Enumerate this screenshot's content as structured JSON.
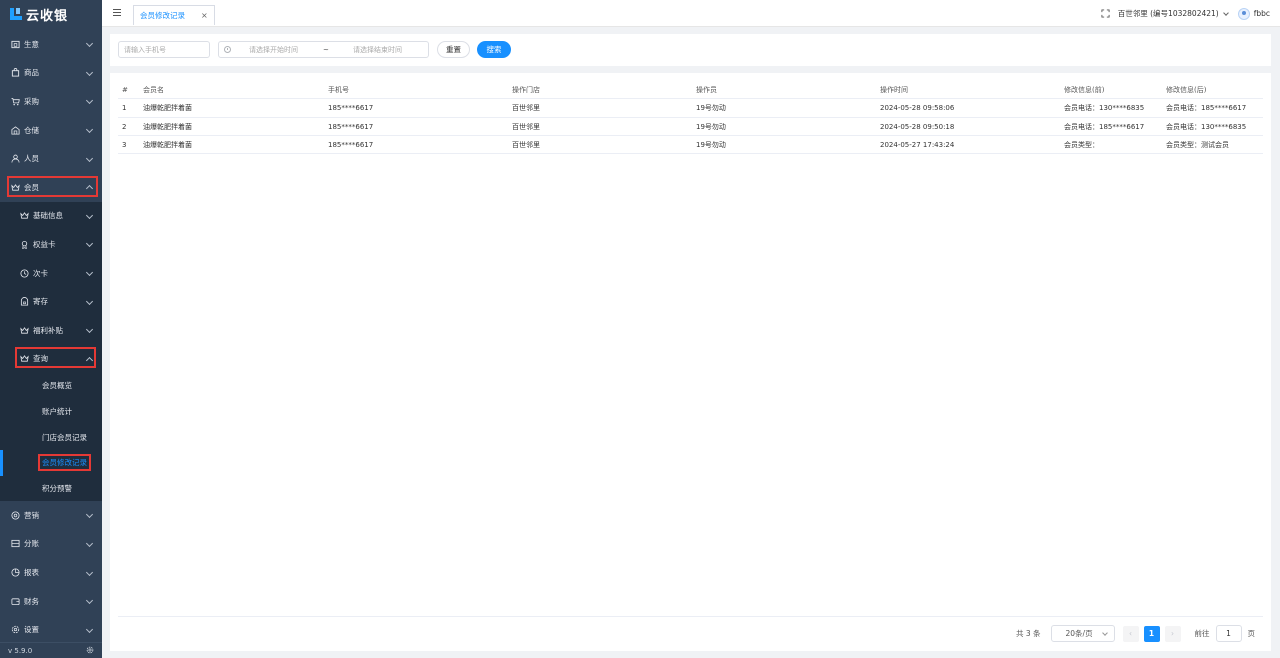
{
  "app": {
    "logo_text": "云收银",
    "version": "v 5.9.0"
  },
  "sidebar": {
    "items": [
      {
        "label": "生意",
        "icon": "store-icon"
      },
      {
        "label": "商品",
        "icon": "bag-icon"
      },
      {
        "label": "采购",
        "icon": "cart-icon"
      },
      {
        "label": "仓储",
        "icon": "warehouse-icon"
      },
      {
        "label": "人员",
        "icon": "user-icon"
      },
      {
        "label": "会员",
        "icon": "crown-icon"
      },
      {
        "label": "基础信息",
        "icon": "crown-icon"
      },
      {
        "label": "权益卡",
        "icon": "card-icon"
      },
      {
        "label": "次卡",
        "icon": "ticket-icon"
      },
      {
        "label": "寄存",
        "icon": "box-icon"
      },
      {
        "label": "福利补贴",
        "icon": "crown-icon"
      },
      {
        "label": "查询",
        "icon": "crown-icon"
      },
      {
        "label": "会员概览"
      },
      {
        "label": "账户统计"
      },
      {
        "label": "门店会员记录"
      },
      {
        "label": "会员修改记录"
      },
      {
        "label": "积分预警"
      },
      {
        "label": "营销",
        "icon": "marketing-icon"
      },
      {
        "label": "分账",
        "icon": "split-icon"
      },
      {
        "label": "报表",
        "icon": "report-icon"
      },
      {
        "label": "财务",
        "icon": "finance-icon"
      },
      {
        "label": "设置",
        "icon": "settings-icon"
      }
    ]
  },
  "header": {
    "tab_label": "会员修改记录",
    "tab_close": "×",
    "store": "百世邻里 (编号1032802421)",
    "user": "fbbc"
  },
  "filter": {
    "phone_placeholder": "请输入手机号",
    "start_placeholder": "请选择开始时间",
    "separator": "~",
    "end_placeholder": "请选择结束时间",
    "reset_label": "重置",
    "search_label": "搜索"
  },
  "table": {
    "columns": [
      "#",
      "会员名",
      "手机号",
      "操作门店",
      "操作员",
      "操作时间",
      "修改信息(前)",
      "修改信息(后)"
    ],
    "rows": [
      [
        "1",
        "油爆乾肥拌着菌",
        "185****6617",
        "百世邻里",
        "19号勿动",
        "2024-05-28 09:58:06",
        "会员电话：130****6835",
        "会员电话：185****6617"
      ],
      [
        "2",
        "油爆乾肥拌着菌",
        "185****6617",
        "百世邻里",
        "19号勿动",
        "2024-05-28 09:50:18",
        "会员电话：185****6617",
        "会员电话：130****6835"
      ],
      [
        "3",
        "油爆乾肥拌着菌",
        "185****6617",
        "百世邻里",
        "19号勿动",
        "2024-05-27 17:43:24",
        "会员类型：",
        "会员类型：测试会员"
      ]
    ]
  },
  "pagination": {
    "total": "共 3 条",
    "page_size": "20条/页",
    "prev": "‹",
    "current": "1",
    "next": "›",
    "goto": "前往",
    "goto_value": "1",
    "page_suffix": "页"
  },
  "colors": {
    "sidebar_bg": "#304156",
    "submenu_bg": "#1f2d3d",
    "accent": "#1890ff",
    "highlight": "#e53935"
  }
}
